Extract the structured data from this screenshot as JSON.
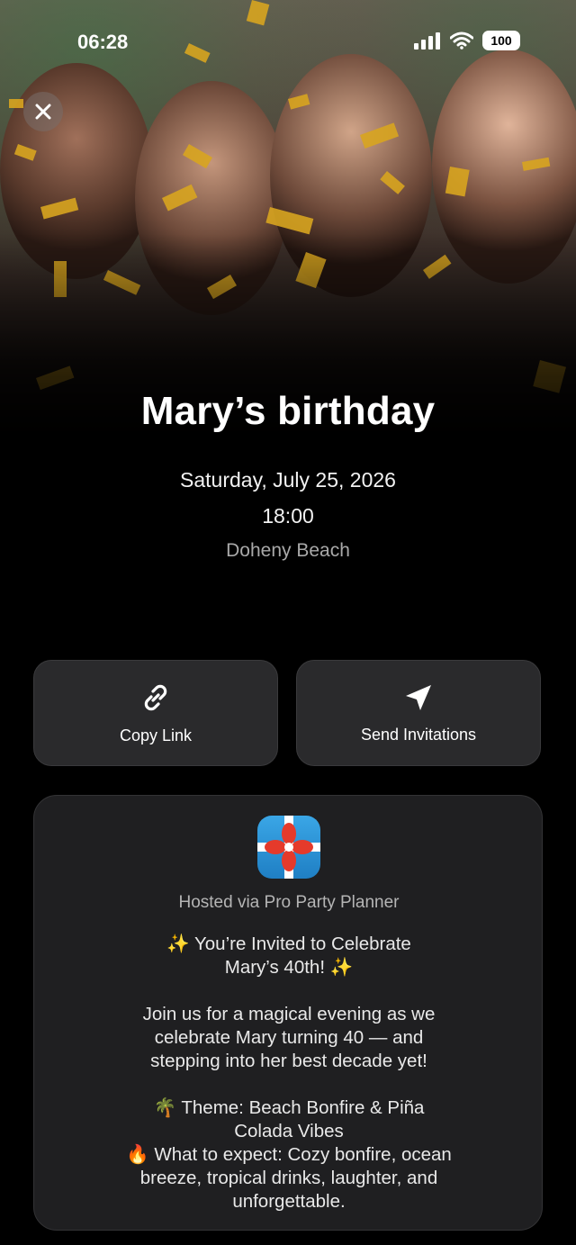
{
  "status_bar": {
    "time": "06:28",
    "battery": "100"
  },
  "event": {
    "title": "Mary’s birthday",
    "date": "Saturday, July 25, 2026",
    "time": "18:00",
    "location": "Doheny Beach"
  },
  "actions": {
    "copy_link": "Copy Link",
    "send_invitations": "Send Invitations"
  },
  "card": {
    "hosted_via": "Hosted via Pro Party Planner",
    "description": "✨ You’re Invited to Celebrate\nMary’s 40th! ✨\n\nJoin us for a magical evening as we\ncelebrate Mary turning 40 — and\nstepping into her best decade yet!\n\n🌴 Theme: Beach Bonfire & Piña\nColada Vibes\n🔥 What to expect: Cozy bonfire, ocean\nbreeze, tropical drinks, laughter, and\nunforgettable."
  },
  "icons": {
    "close": "close-icon",
    "link": "link-icon",
    "send": "send-icon",
    "app": "pro-party-planner-app-icon"
  }
}
